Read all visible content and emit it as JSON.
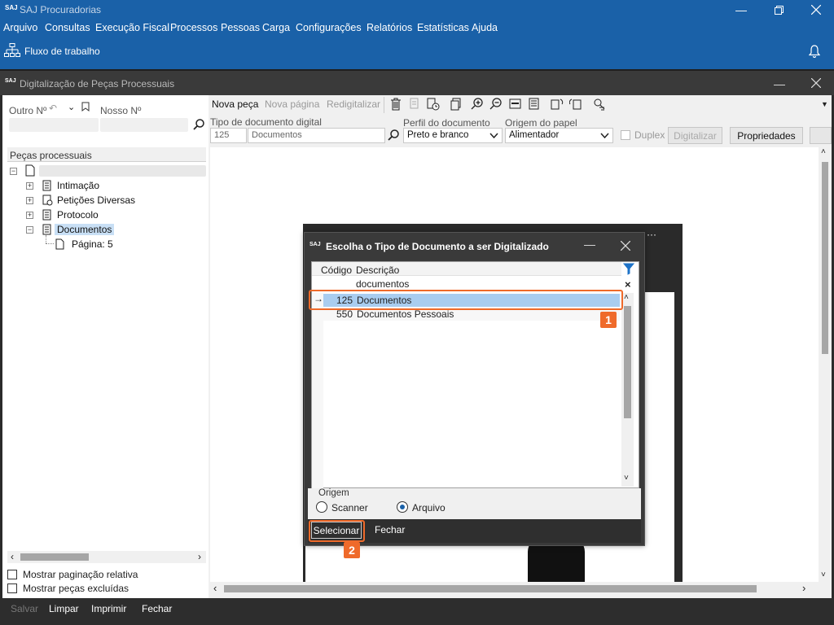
{
  "app": {
    "logo": "SAJ",
    "title": "SAJ Procuradorias"
  },
  "menu": [
    "Arquivo",
    "Consultas",
    "Execução Fiscal",
    "Processos",
    "Pessoas",
    "Carga",
    "Configurações",
    "Relatórios",
    "Estatísticas",
    "Ajuda"
  ],
  "toolstrip": {
    "workflow_label": "Fluxo de trabalho"
  },
  "inner_window": {
    "logo": "SAJ",
    "title": "Digitalização de Peças Processuais"
  },
  "left": {
    "outro_label": "Outro Nº",
    "nosso_label": "Nosso Nº",
    "tree_header": "Peças processuais",
    "tree": [
      "Intimação",
      "Petições Diversas",
      "Protocolo",
      "Documentos"
    ],
    "page_node": "Página: 5",
    "chk_paginacao": "Mostrar paginação relativa",
    "chk_excluidas": "Mostrar peças excluídas"
  },
  "toolbar": {
    "nova_peca": "Nova peça",
    "nova_pagina": "Nova página",
    "redigitalizar": "Redigitalizar"
  },
  "form": {
    "tipo_label": "Tipo de documento digital",
    "tipo_code": "125",
    "tipo_desc": "Documentos",
    "perfil_label": "Perfil do documento",
    "perfil_value": "Preto e branco",
    "origem_label": "Origem do papel",
    "origem_value": "Alimentador",
    "duplex_label": "Duplex",
    "digitalizar_label": "Digitalizar",
    "propriedades_label": "Propriedades"
  },
  "dialog": {
    "logo": "SAJ",
    "title": "Escolha o Tipo de Documento a ser Digitalizado",
    "col_codigo": "Código",
    "col_descricao": "Descrição",
    "filter_value": "documentos",
    "rows": [
      {
        "code": "125",
        "desc": "Documentos",
        "selected": true
      },
      {
        "code": "550",
        "desc": "Documentos Pessoais",
        "selected": false
      }
    ],
    "origem_group": "Origem",
    "opt_scanner": "Scanner",
    "opt_arquivo": "Arquivo",
    "selected_origem": "Arquivo",
    "btn_selecionar": "Selecionar",
    "btn_fechar": "Fechar"
  },
  "annotations": {
    "badge1": "1",
    "badge2": "2"
  },
  "footer": {
    "salvar": "Salvar",
    "limpar": "Limpar",
    "imprimir": "Imprimir",
    "fechar": "Fechar"
  },
  "colors": {
    "brand_blue": "#1a61a8",
    "highlight_orange": "#ef6a2a",
    "selection_blue": "#a9cdf0"
  }
}
